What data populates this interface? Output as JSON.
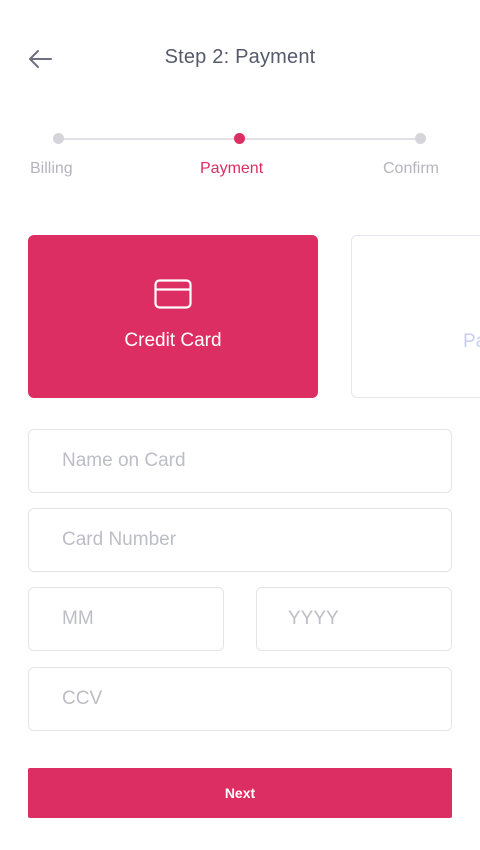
{
  "header": {
    "title": "Step 2: Payment",
    "back_icon": "arrow-left-icon"
  },
  "stepper": {
    "steps": [
      {
        "label": "Billing",
        "state": "done"
      },
      {
        "label": "Payment",
        "state": "active"
      },
      {
        "label": "Confirm",
        "state": "pending"
      }
    ]
  },
  "payment_methods": [
    {
      "label": "Credit Card",
      "icon": "credit-card-icon",
      "selected": true
    },
    {
      "label": "Pa",
      "selected": false
    }
  ],
  "form": {
    "name_placeholder": "Name on Card",
    "name_value": "",
    "card_number_placeholder": "Card Number",
    "card_number_value": "",
    "month_placeholder": "MM",
    "month_value": "",
    "year_placeholder": "YYYY",
    "year_value": "",
    "ccv_placeholder": "CCV",
    "ccv_value": ""
  },
  "actions": {
    "next_label": "Next"
  },
  "colors": {
    "accent": "#dd2e63",
    "muted_text": "#b5b5bd",
    "border": "#e3e3ea"
  }
}
